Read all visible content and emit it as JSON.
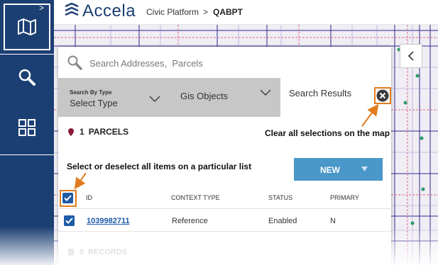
{
  "nav": {
    "items": [
      {
        "icon": "map-icon",
        "active": true
      },
      {
        "icon": "search-icon",
        "active": false
      },
      {
        "icon": "grid-icon",
        "active": false
      }
    ],
    "expand_glyph": ">"
  },
  "header": {
    "logo_text": "Accela",
    "product": "Civic Platform",
    "separator": ">",
    "environment": "QABPT"
  },
  "search": {
    "placeholder": "Search Addresses,  Parcels"
  },
  "tabs": {
    "search_by_type": {
      "small_label": "Search By Type",
      "value": "Select Type"
    },
    "gis_objects": {
      "label": "Gis Objects"
    },
    "search_results": {
      "label": "Search Results"
    }
  },
  "parcels": {
    "count": "1",
    "label": "PARCELS"
  },
  "new_button": {
    "label": "NEW"
  },
  "table": {
    "columns": [
      "ID",
      "CONTEXT TYPE",
      "STATUS",
      "PRIMARY"
    ],
    "rows": [
      {
        "id": "1039982711",
        "context_type": "Reference",
        "status": "Enabled",
        "primary": "N",
        "checked": true
      }
    ]
  },
  "records": {
    "count": "0",
    "label": "RECORDS"
  },
  "annotations": {
    "clear_all": "Clear all selections on the map",
    "select_all": "Select or deselect all items on a particular list"
  },
  "colors": {
    "nav_bg": "#1c3f73",
    "new_button": "#4a97c9",
    "callout": "#e07c1f",
    "checkbox": "#1e5aa8",
    "tab_gray": "#c7c7c7",
    "parcel_pin": "#8b1a3a"
  }
}
